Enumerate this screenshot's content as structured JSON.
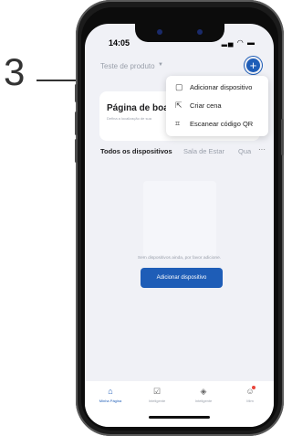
{
  "callout": {
    "number": "3"
  },
  "status_bar": {
    "time": "14:05",
    "icons": "▂▄ ◠ ▬"
  },
  "header": {
    "home_name": "Teste de produto",
    "caret": "▼",
    "add_icon": "plus-icon",
    "add_symbol": "+"
  },
  "welcome_card": {
    "title": "Página de boas",
    "subtitle": "Defina a localização de sua"
  },
  "menu": {
    "items": [
      {
        "icon": "device-icon",
        "glyph": "▢",
        "label": "Adicionar dispositivo"
      },
      {
        "icon": "scene-icon",
        "glyph": "⇱",
        "label": "Criar cena"
      },
      {
        "icon": "qr-scan-icon",
        "glyph": "⌗",
        "label": "Escanear código QR"
      }
    ]
  },
  "tabs": {
    "items": [
      "Todos os dispositivos",
      "Sala de Estar",
      "Qua"
    ],
    "more": "···"
  },
  "empty_state": {
    "text": "Sem dispositivos ainda, por favor adicione.",
    "button_label": "Adicionar dispositivo"
  },
  "bottom_nav": {
    "items": [
      {
        "label": "Minha Página",
        "icon": "home-icon",
        "glyph": "⌂",
        "active": true
      },
      {
        "label": "Inteligente",
        "icon": "smart-icon",
        "glyph": "☑",
        "active": false
      },
      {
        "label": "Inteligente",
        "icon": "shield-icon",
        "glyph": "◈",
        "active": false
      },
      {
        "label": "Mim",
        "icon": "profile-icon",
        "glyph": "☺",
        "active": false
      }
    ]
  },
  "colors": {
    "accent": "#1e5db7",
    "background": "#f0f1f6",
    "muted_text": "#9aa0ab"
  }
}
